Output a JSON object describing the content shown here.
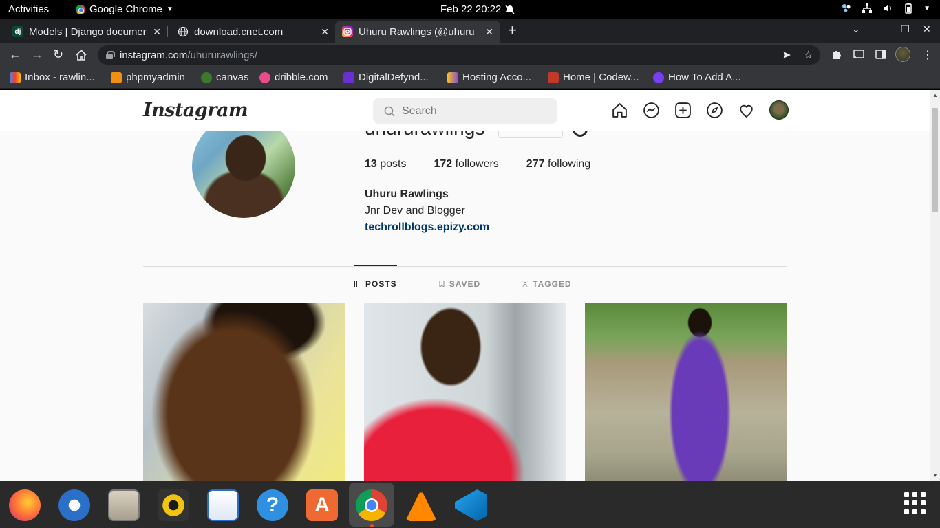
{
  "system": {
    "activities": "Activities",
    "app_name": "Google Chrome",
    "clock": "Feb 22  20:22"
  },
  "tabs": [
    {
      "label": "Models | Django documer",
      "favicon": "dj"
    },
    {
      "label": "download.cnet.com",
      "favicon": ""
    },
    {
      "label": "Uhuru Rawlings (@uhuru",
      "favicon": ""
    }
  ],
  "address": {
    "host": "instagram.com",
    "path": "/uhururawlings/"
  },
  "bookmarks": [
    {
      "label": "Inbox - rawlin...",
      "color": "#ea4335"
    },
    {
      "label": "phpmyadmin",
      "color": "#f29111"
    },
    {
      "label": "canvas",
      "color": "#3c7a2a"
    },
    {
      "label": "dribble.com",
      "color": "#ea4c89"
    },
    {
      "label": "DigitalDefynd...",
      "color": "#6b2fd6"
    },
    {
      "label": "Hosting Acco...",
      "color": "#8a4ad6"
    },
    {
      "label": "Home | Codew...",
      "color": "#c0392b"
    },
    {
      "label": "How To Add A...",
      "color": "#7b3ff2"
    }
  ],
  "instagram": {
    "logo": "Instagram",
    "search_placeholder": "Search",
    "username": "uhururawlings",
    "stats": {
      "posts_count": "13",
      "posts_label": "posts",
      "followers_count": "172",
      "followers_label": "followers",
      "following_count": "277",
      "following_label": "following"
    },
    "full_name": "Uhuru Rawlings",
    "bio": "Jnr Dev and Blogger",
    "website": "techrollblogs.epizy.com",
    "profile_tabs": {
      "posts": "POSTS",
      "saved": "SAVED",
      "tagged": "TAGGED"
    }
  },
  "colors": {
    "link": "#00376b",
    "text": "#262626",
    "muted": "#8e8e8e"
  }
}
